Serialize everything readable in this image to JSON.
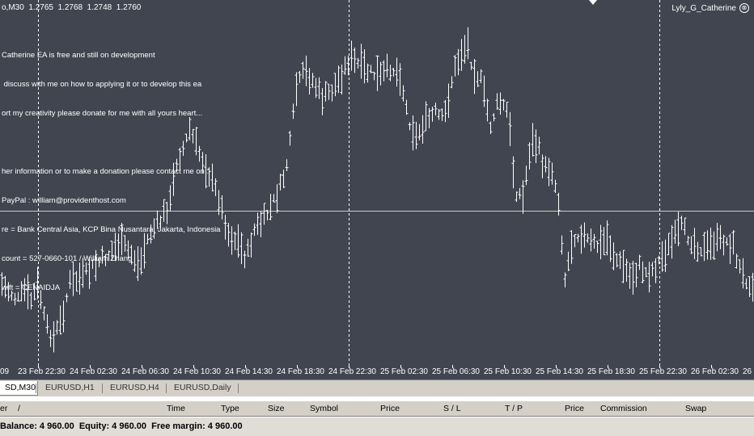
{
  "chart": {
    "title": "o,M30  1.2765  1.2768  1.2748  1.2760",
    "ea_name": "Lyly_G_Catherine",
    "close_symbol": "⊗",
    "comment_lines": [
      "Catherine EA is free and still on development",
      " discuss with me on how to applying it or to develop this ea",
      "ort my creativity please donate for me with all yours heart...",
      "",
      "her information or to make a donation please contact me on :",
      "PayPal : william@providenthost.com",
      "re = Bank Central Asia, KCP Bina Nusantara, Jakarta, Indonesia",
      "count = 527-0660-101 / William Zhang",
      "wift = CENAIDJA"
    ],
    "colors": {
      "background": "#404550",
      "bars": "#ffffff",
      "grid": "#ffffff"
    },
    "time_labels": [
      "09",
      "23 Feb 22:30",
      "24 Feb 02:30",
      "24 Feb 06:30",
      "24 Feb 10:30",
      "24 Feb 14:30",
      "24 Feb 18:30",
      "24 Feb 22:30",
      "25 Feb 02:30",
      "25 Feb 06:30",
      "25 Feb 10:30",
      "25 Feb 14:30",
      "25 Feb 18:30",
      "25 Feb 22:30",
      "26 Feb 02:30",
      "26"
    ]
  },
  "tabs": [
    "SD,M30",
    "EURUSD,H1",
    "EURUSD,H4",
    "EURUSD,Daily"
  ],
  "terminal": {
    "columns": [
      "er",
      "/",
      "Time",
      "Type",
      "Size",
      "Symbol",
      "Price",
      "S / L",
      "T / P",
      "Price",
      "Commission",
      "Swap"
    ],
    "balance_text": "Balance: 4 960.00  Equity: 4 960.00  Free margin: 4 960.00"
  }
}
